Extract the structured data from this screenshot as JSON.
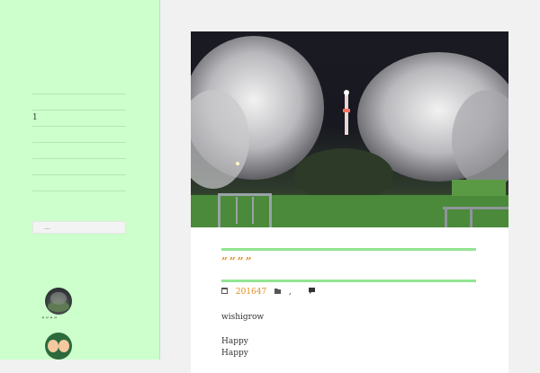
{
  "sidebar": {
    "list_items": [
      "",
      "1",
      "",
      "",
      "",
      ""
    ],
    "search_placeholder": "...",
    "avatar_caption": "””””"
  },
  "post": {
    "title": "””””",
    "date": "201647",
    "category_sep": ",",
    "paragraph_1": "wishigrow",
    "paragraph_2": "Happy",
    "paragraph_3": "Happy"
  },
  "colors": {
    "sidebar_bg": "#ccffcc",
    "accent_rule": "#92e592",
    "link_orange": "#e08a1e"
  },
  "icons": {
    "calendar": "calendar-icon",
    "folder": "folder-icon",
    "comment": "comment-icon"
  }
}
